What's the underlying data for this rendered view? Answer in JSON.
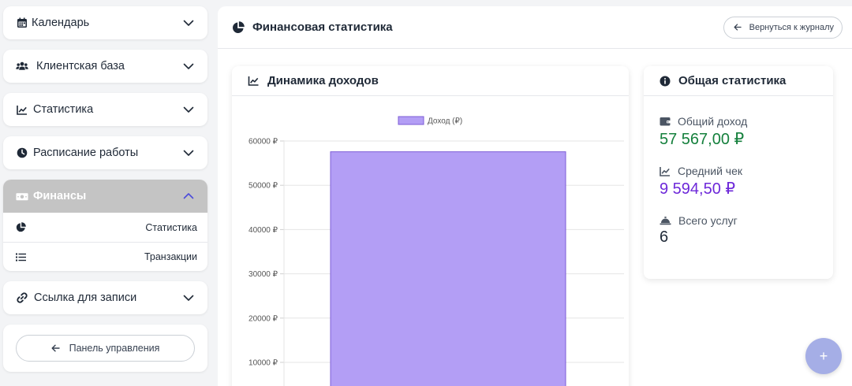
{
  "sidebar": {
    "calendar": "Календарь",
    "clients": "Клиентская база",
    "statistics": "Статистика",
    "schedule": "Расписание работы",
    "finance": {
      "label": "Финансы",
      "items": [
        "Статистика",
        "Транзакции"
      ]
    },
    "booking_link": "Ссылка для записи",
    "dashboard_button": "Панель управления"
  },
  "main": {
    "title": "Финансовая статистика",
    "back_button": "Вернуться к журналу"
  },
  "income_panel": {
    "title": "Динамика доходов"
  },
  "stats_panel": {
    "title": "Общая статистика",
    "total_income_label": "Общий доход",
    "total_income_value": "57 567,00 ₽",
    "avg_check_label": "Средний чек",
    "avg_check_value": "9 594,50 ₽",
    "services_label": "Всего услуг",
    "services_value": "6"
  },
  "colors": {
    "income_green": "#15803d",
    "avg_purple": "#6d28d9",
    "bar_fill": "#b39ef5",
    "bar_stroke": "#7c5cd6"
  },
  "fab": {
    "label": "+"
  },
  "chart_data": {
    "type": "bar",
    "categories": [
      ""
    ],
    "series": [
      {
        "name": "Доход (₽)",
        "values": [
          57567
        ]
      }
    ],
    "y_ticks": [
      "10000 ₽",
      "20000 ₽",
      "30000 ₽",
      "40000 ₽",
      "50000 ₽",
      "60000 ₽"
    ],
    "ylim": [
      0,
      60000
    ],
    "grid": true,
    "legend": "top-center"
  }
}
